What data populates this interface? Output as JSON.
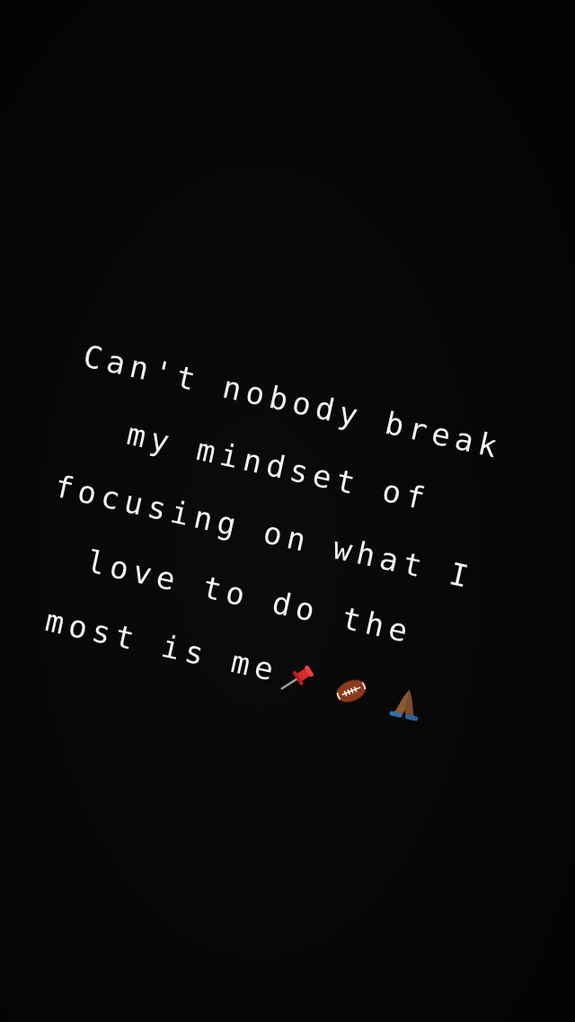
{
  "caption": {
    "lines": [
      "Can't nobody break",
      "my mindset of",
      "focusing on what I",
      "love to do the",
      "most is me"
    ],
    "emojis": [
      "pushpin-icon",
      "american-football-icon",
      "folded-hands-icon"
    ]
  },
  "colors": {
    "background": "#050405",
    "text": "#f4f4f4"
  }
}
